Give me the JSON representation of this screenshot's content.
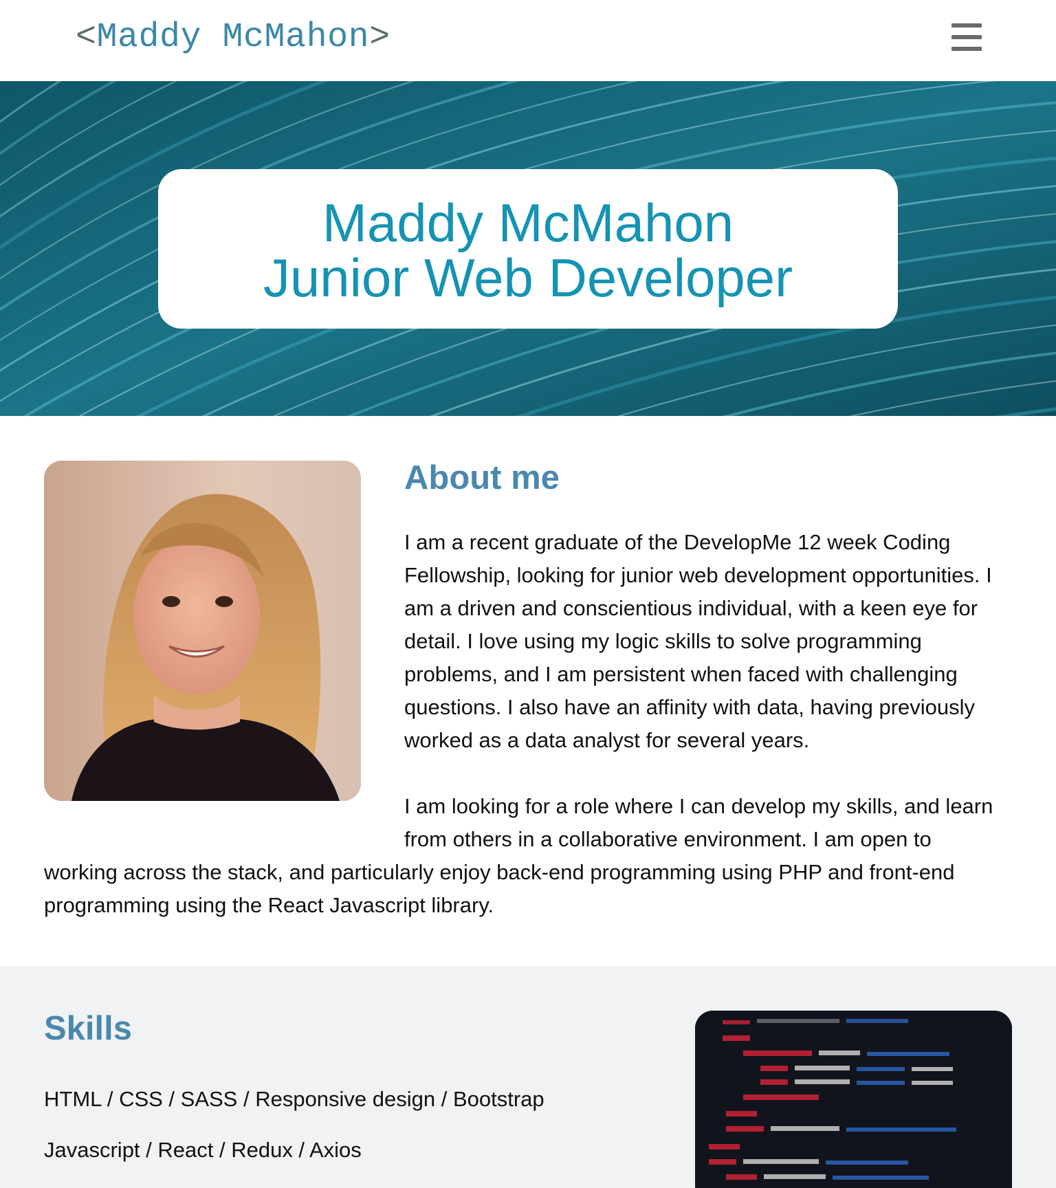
{
  "header": {
    "logo_open": "<",
    "logo_name": "Maddy McMahon",
    "logo_close": ">",
    "menu_icon": "hamburger-menu-icon"
  },
  "hero": {
    "name": "Maddy McMahon",
    "role": "Junior Web Developer",
    "background_color": "#155c6d",
    "accent_color": "#1593b3"
  },
  "about": {
    "title": "About me",
    "paragraph1": "I am a recent graduate of the DevelopMe 12 week Coding Fellowship, looking for junior web development opportunities. I am a driven and conscientious individual, with a keen eye for detail. I love using my logic skills to solve programming problems, and I am persistent when faced with challenging questions. I also have an affinity with data, having previously worked as a data analyst for several years.",
    "paragraph2_a": "I am looking for a role where I can develop my skills, and learn from others in a collaborative environment. I am open to",
    "paragraph2_b": "working across the stack, and particularly enjoy back-end programming using PHP and front-end programming using the React Javascript library."
  },
  "skills": {
    "title": "Skills",
    "lines": [
      "HTML / CSS / SASS / Responsive design / Bootstrap",
      "Javascript / React / Redux / Axios"
    ]
  },
  "theme": {
    "heading_color": "#4a88ad",
    "logo_color": "#3b87a8"
  }
}
